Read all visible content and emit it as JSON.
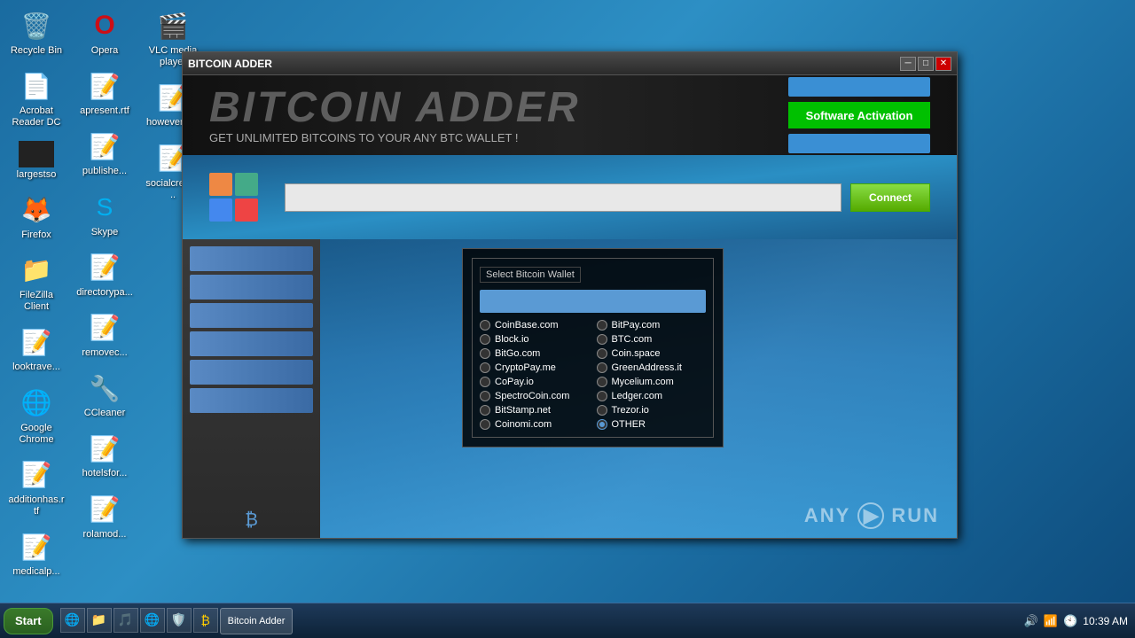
{
  "desktop": {
    "icons": [
      {
        "id": "recycle-bin",
        "label": "Recycle Bin",
        "icon": "🗑️"
      },
      {
        "id": "acrobat",
        "label": "Acrobat Reader DC",
        "icon": "📄"
      },
      {
        "id": "largestso",
        "label": "largestso",
        "icon": "⬛"
      },
      {
        "id": "firefox",
        "label": "Firefox",
        "icon": "🦊"
      },
      {
        "id": "filezilla",
        "label": "FileZilla Client",
        "icon": "📁"
      },
      {
        "id": "looktrave",
        "label": "looktrave...",
        "icon": "📝"
      },
      {
        "id": "google-chrome",
        "label": "Google Chrome",
        "icon": "🌐"
      },
      {
        "id": "additionhas",
        "label": "additionhas.rtf",
        "icon": "📝"
      },
      {
        "id": "medicalp",
        "label": "medicalp...",
        "icon": "📝"
      },
      {
        "id": "opera",
        "label": "Opera",
        "icon": "🅾️"
      },
      {
        "id": "apresent",
        "label": "apresent.rtf",
        "icon": "📝"
      },
      {
        "id": "publishe",
        "label": "publishe...",
        "icon": "📝"
      },
      {
        "id": "skype",
        "label": "Skype",
        "icon": "💬"
      },
      {
        "id": "directorypa",
        "label": "directorypa...",
        "icon": "📝"
      },
      {
        "id": "removec",
        "label": "removec...",
        "icon": "📝"
      },
      {
        "id": "ccleaner",
        "label": "CCleaner",
        "icon": "🔧"
      },
      {
        "id": "hotelsfor",
        "label": "hotelsfor...",
        "icon": "📝"
      },
      {
        "id": "rolamod",
        "label": "rolamod...",
        "icon": "📝"
      },
      {
        "id": "vlc",
        "label": "VLC media player",
        "icon": "🎬"
      },
      {
        "id": "howeverto",
        "label": "howeverto...",
        "icon": "📝"
      },
      {
        "id": "socialcredit",
        "label": "socialcredit,...",
        "icon": "📝"
      }
    ]
  },
  "window": {
    "title": "BITCOIN ADDER",
    "min_btn": "─",
    "max_btn": "□",
    "close_btn": "✕"
  },
  "bitcoin_app": {
    "title": "BITCOIN ADDER",
    "subtitle": "GET UNLIMITED BITCOINS TO YOUR ANY BTC WALLET !",
    "activation_btn": "Software Activation",
    "wallet_placeholder": "",
    "connect_btn": "Connect",
    "wallet_selector_title": "Select Bitcoin Wallet",
    "wallets_left": [
      {
        "id": "coinbase",
        "label": "CoinBase.com",
        "selected": false
      },
      {
        "id": "blockio",
        "label": "Block.io",
        "selected": false
      },
      {
        "id": "bitgo",
        "label": "BitGo.com",
        "selected": false
      },
      {
        "id": "cryptopay",
        "label": "CryptoPay.me",
        "selected": false
      },
      {
        "id": "copay",
        "label": "CoPay.io",
        "selected": false
      },
      {
        "id": "spectrocoin",
        "label": "SpectroCoin.com",
        "selected": false
      },
      {
        "id": "bitstamp",
        "label": "BitStamp.net",
        "selected": false
      },
      {
        "id": "coinomi",
        "label": "Coinomi.com",
        "selected": false
      }
    ],
    "wallets_right": [
      {
        "id": "bitpay",
        "label": "BitPay.com",
        "selected": false
      },
      {
        "id": "btccom",
        "label": "BTC.com",
        "selected": false
      },
      {
        "id": "coinspace",
        "label": "Coin.space",
        "selected": true
      },
      {
        "id": "greenaddress",
        "label": "GreenAddress.it",
        "selected": false
      },
      {
        "id": "mycelium",
        "label": "Mycelium.com",
        "selected": false
      },
      {
        "id": "ledger",
        "label": "Ledger.com",
        "selected": false
      },
      {
        "id": "trezor",
        "label": "Trezor.io",
        "selected": false
      },
      {
        "id": "other",
        "label": "OTHER",
        "selected": true
      }
    ]
  },
  "taskbar": {
    "start_label": "Start",
    "time": "10:39 AM",
    "apps": [
      {
        "label": "Bitcoin Adder"
      }
    ],
    "tray_icons": [
      "🔊",
      "📶",
      "⏰"
    ]
  },
  "anyrun": {
    "label": "ANY▶RUN"
  }
}
